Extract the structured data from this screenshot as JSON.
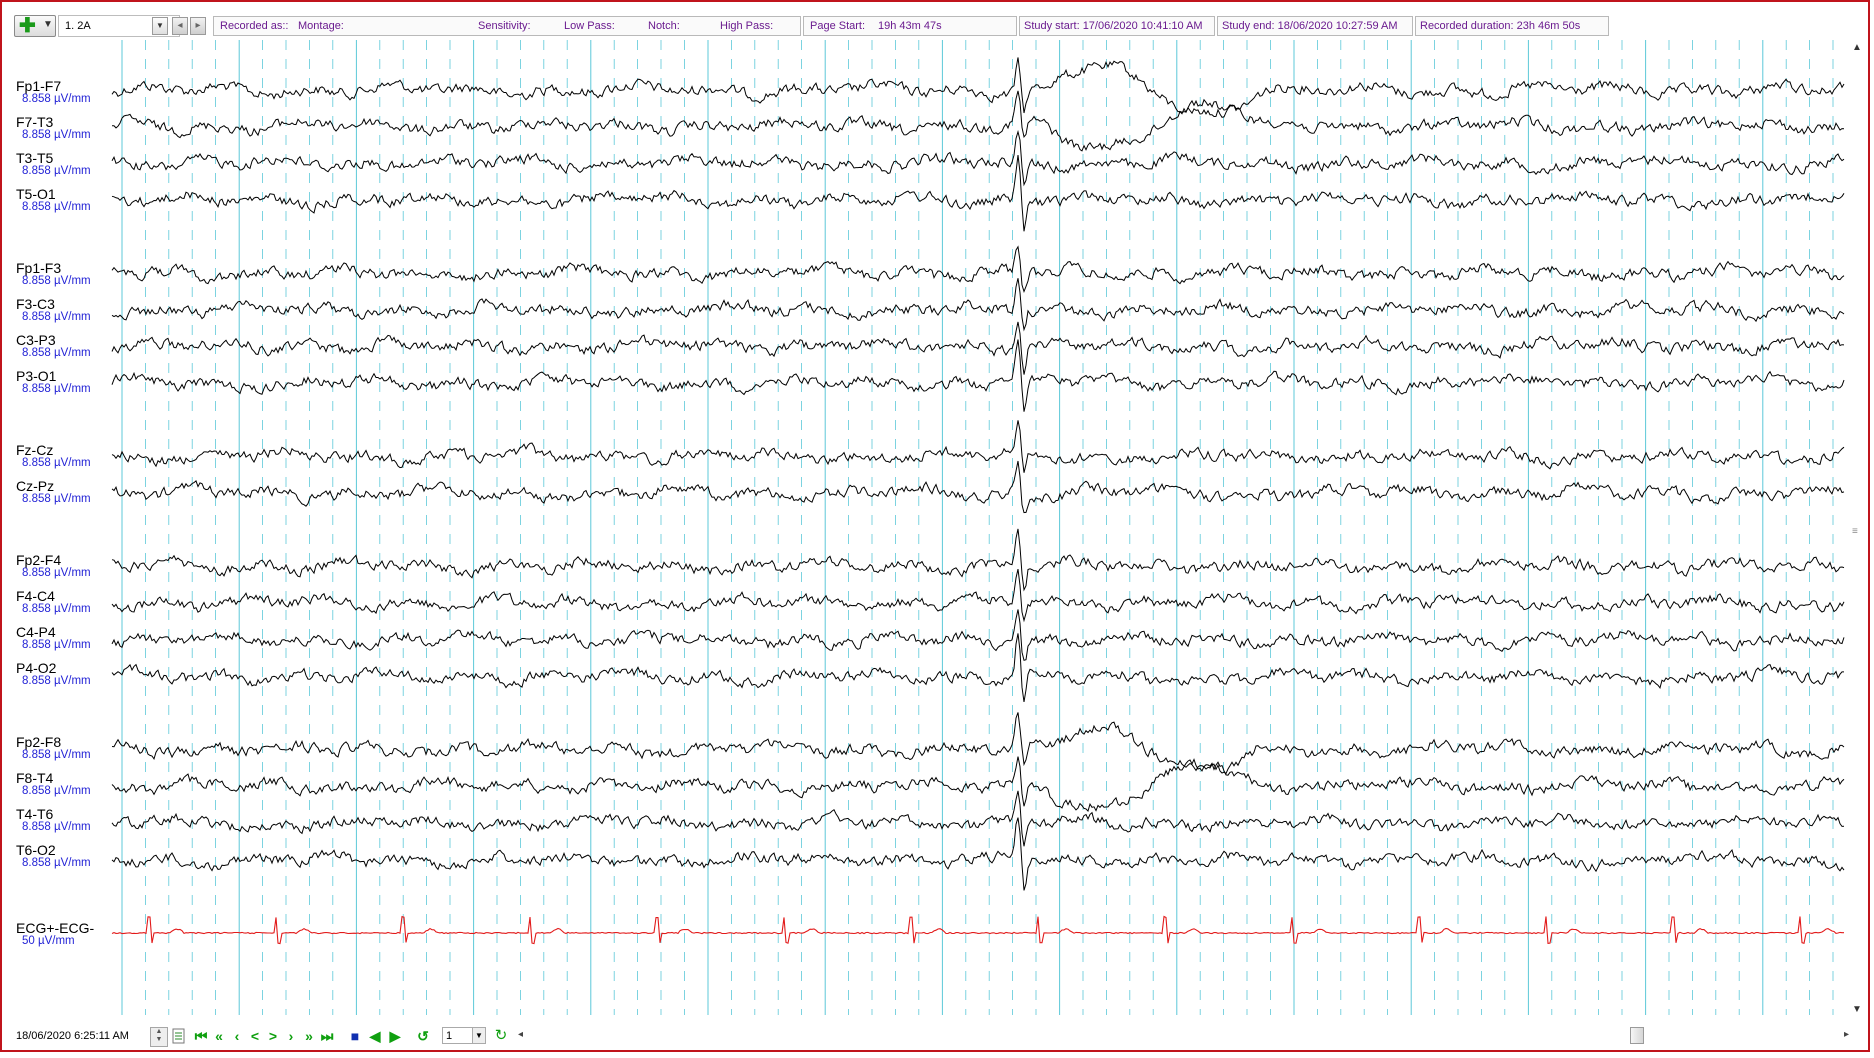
{
  "toolbar": {
    "add_icon": "plus-icon",
    "montage": "1. 2A",
    "recorded_as_label": "Recorded as::",
    "montage_label": "Montage:",
    "sensitivity_label": "Sensitivity:",
    "low_pass_label": "Low Pass:",
    "notch_label": "Notch:",
    "high_pass_label": "High Pass:",
    "page_start_label": "Page Start:",
    "page_start_value": "19h 43m 47s",
    "study_start": "Study start: 17/06/2020 10:41:10 AM",
    "study_end": "Study end: 18/06/2020 10:27:59 AM",
    "recorded_duration": "Recorded duration: 23h 46m 50s"
  },
  "channels": [
    {
      "label": "Fp1-F7",
      "sensitivity": "8.858 µV/mm"
    },
    {
      "label": "F7-T3",
      "sensitivity": "8.858 µV/mm"
    },
    {
      "label": "T3-T5",
      "sensitivity": "8.858 µV/mm"
    },
    {
      "label": "T5-O1",
      "sensitivity": "8.858 µV/mm"
    },
    {
      "label": "Fp1-F3",
      "sensitivity": "8.858 µV/mm"
    },
    {
      "label": "F3-C3",
      "sensitivity": "8.858 µV/mm"
    },
    {
      "label": "C3-P3",
      "sensitivity": "8.858 µV/mm"
    },
    {
      "label": "P3-O1",
      "sensitivity": "8.858 µV/mm"
    },
    {
      "label": "Fz-Cz",
      "sensitivity": "8.858 µV/mm"
    },
    {
      "label": "Cz-Pz",
      "sensitivity": "8.858 µV/mm"
    },
    {
      "label": "Fp2-F4",
      "sensitivity": "8.858 µV/mm"
    },
    {
      "label": "F4-C4",
      "sensitivity": "8.858 µV/mm"
    },
    {
      "label": "C4-P4",
      "sensitivity": "8.858 µV/mm"
    },
    {
      "label": "P4-O2",
      "sensitivity": "8.858 µV/mm"
    },
    {
      "label": "Fp2-F8",
      "sensitivity": "8.858 µV/mm"
    },
    {
      "label": "F8-T4",
      "sensitivity": "8.858 µV/mm"
    },
    {
      "label": "T4-T6",
      "sensitivity": "8.858 µV/mm"
    },
    {
      "label": "T6-O2",
      "sensitivity": "8.858 µV/mm"
    },
    {
      "label": "ECG+-ECG-",
      "sensitivity": "50 µV/mm",
      "color": "#e21a1a"
    }
  ],
  "colors": {
    "frame_border": "#c0141c",
    "trace": "#000000",
    "ecg_trace": "#e21a1a",
    "gridline": "#5cc8d8",
    "label_text": "#000000",
    "sensitivity_text": "#2323d6",
    "toolbar_text": "#6a1b8f"
  },
  "bottombar": {
    "datetime": "18/06/2020   6:25:11 AM",
    "page_number": "1",
    "nav_icons": [
      "first-icon",
      "rewind-icon",
      "prev-page-icon",
      "prev-icon",
      "next-icon",
      "next-page-icon",
      "fast-forward-icon",
      "last-icon",
      "stop-icon",
      "play-back-icon",
      "play-icon",
      "undo-icon",
      "refresh-icon"
    ]
  }
}
